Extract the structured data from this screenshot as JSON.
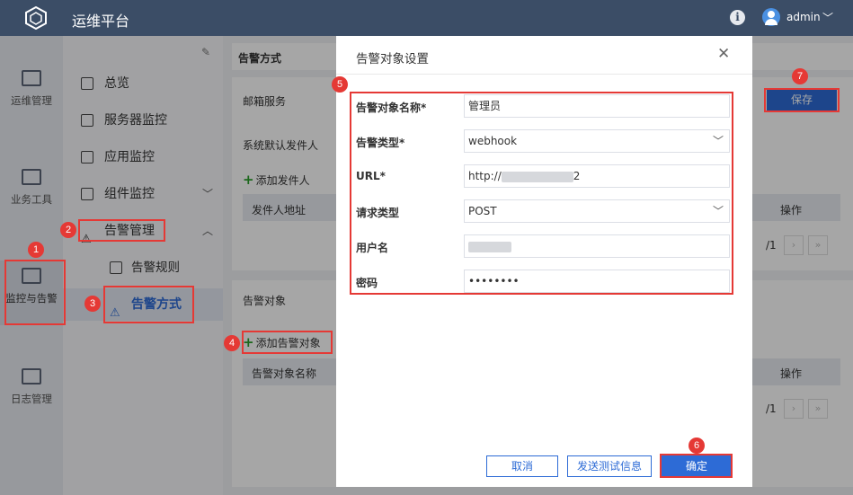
{
  "app": {
    "title": "运维平台",
    "user": "admin"
  },
  "nav1": [
    {
      "label": "运维管理"
    },
    {
      "label": "业务工具"
    },
    {
      "label": "监控与告警"
    },
    {
      "label": "日志管理"
    }
  ],
  "nav2": [
    {
      "label": "总览"
    },
    {
      "label": "服务器监控"
    },
    {
      "label": "应用监控"
    },
    {
      "label": "组件监控"
    },
    {
      "label": "告警管理"
    },
    {
      "label": "告警规则"
    },
    {
      "label": "告警方式"
    }
  ],
  "content": {
    "title": "告警方式",
    "mail_section": "邮箱服务",
    "default_sender": "系统默认发件人",
    "add_sender": "添加发件人",
    "sender_col": "发件人地址",
    "ops_col": "操作",
    "target_section": "告警对象",
    "add_target": "添加告警对象",
    "target_col": "告警对象名称",
    "pager_total": "/1",
    "save": "保存"
  },
  "dialog": {
    "title": "告警对象设置",
    "fields": [
      {
        "label": "告警对象名称*",
        "value": "管理员"
      },
      {
        "label": "告警类型*",
        "value": "webhook"
      },
      {
        "label": "URL*",
        "value_prefix": "http://",
        "value_suffix": "2"
      },
      {
        "label": "请求类型",
        "value": "POST"
      },
      {
        "label": "用户名",
        "value": ""
      },
      {
        "label": "密码",
        "value": "••••••••"
      }
    ],
    "cancel": "取消",
    "test": "发送测试信息",
    "ok": "确定"
  },
  "annotations": [
    "1",
    "2",
    "3",
    "4",
    "5",
    "6",
    "7"
  ],
  "colors": {
    "topbar": "#3b4d66",
    "primary": "#2d6bd6",
    "annotation": "#e53935"
  }
}
